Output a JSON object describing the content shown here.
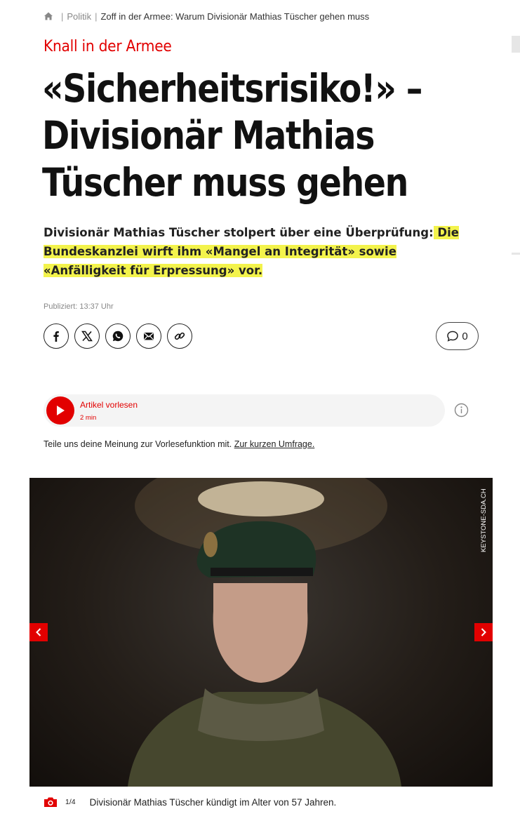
{
  "breadcrumb": {
    "home_icon": "home-icon",
    "section": "Politik",
    "current": "Zoff in der Armee: Warum Divisionär Mathias Tüscher gehen muss"
  },
  "article": {
    "kicker": "Knall in der Armee",
    "headline": {
      "line1": "«Sicherheitsrisiko!» –",
      "line2": "Divisionär Mathias",
      "line3": "Tüscher muss gehen"
    },
    "lead_plain": "Divisionär Mathias Tüscher stolpert über eine Überprüfung:",
    "lead_highlighted": " Die Bundeskanzlei wirft ihm «Mangel an Integrität» sowie «Anfälligkeit für Erpressung» vor.",
    "published": "Publiziert: 13:37 Uhr"
  },
  "share": {
    "icons": [
      "facebook-icon",
      "x-icon",
      "whatsapp-icon",
      "email-icon",
      "link-icon"
    ]
  },
  "comments": {
    "icon": "comment-icon",
    "count": "0"
  },
  "audio": {
    "title": "Artikel vorlesen",
    "duration": "2 min",
    "play_icon": "play-icon",
    "info_icon": "info-icon"
  },
  "feedback": {
    "text": "Teile uns deine Meinung zur Vorlesefunktion mit. ",
    "link": "Zur kurzen Umfrage."
  },
  "gallery": {
    "credit": "KEYSTONE-SDA.CH",
    "counter": "1/4",
    "caption": "Divisionär Mathias Tüscher kündigt im Alter von 57 Jahren.",
    "camera_icon": "camera-icon"
  },
  "colors": {
    "accent": "#e20000",
    "highlight": "#f3f34c"
  }
}
